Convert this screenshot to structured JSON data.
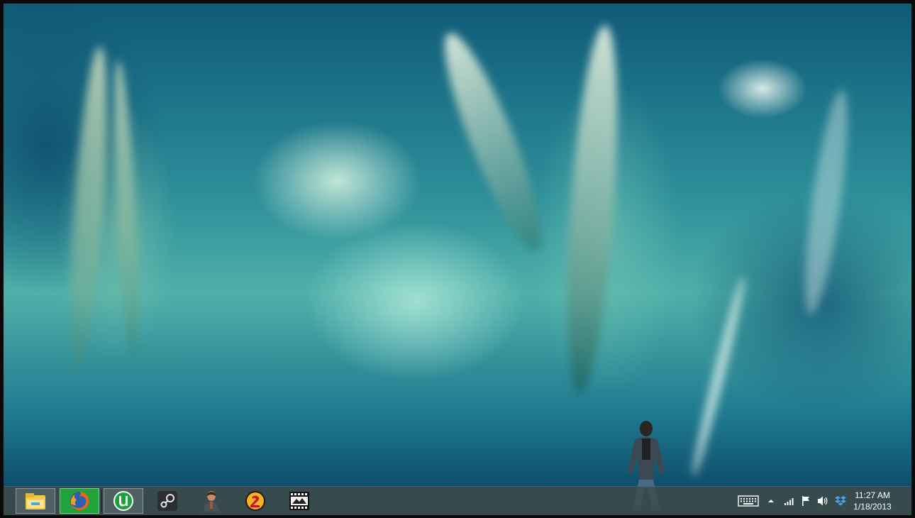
{
  "desktop": {
    "wallpaper": "blurred teal wheat stalks",
    "colors": {
      "dark_teal": "#0f5a78",
      "mid_teal": "#2d8f9a",
      "light": "#dff3e6"
    }
  },
  "taskbar": {
    "apps": [
      {
        "name": "file-explorer-icon",
        "state": "pinned"
      },
      {
        "name": "firefox-icon",
        "state": "active"
      },
      {
        "name": "utorrent-icon",
        "state": "pinned"
      },
      {
        "name": "steam-icon",
        "state": "normal"
      },
      {
        "name": "game-character-icon",
        "state": "normal"
      },
      {
        "name": "borderlands-2-icon",
        "state": "normal"
      },
      {
        "name": "movie-maker-icon",
        "state": "normal"
      }
    ],
    "tray": {
      "icons": [
        "keyboard-icon",
        "show-hidden-icons-arrow",
        "network-signal-icon",
        "action-center-flag-icon",
        "volume-icon",
        "dropbox-icon"
      ]
    },
    "clock": {
      "time": "11:27 AM",
      "date": "1/18/2013"
    }
  }
}
